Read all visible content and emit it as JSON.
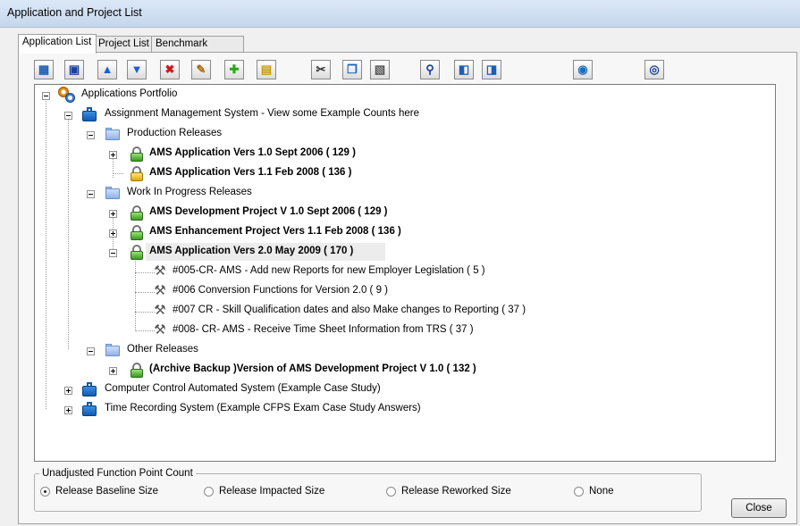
{
  "window": {
    "title": "Application and Project List"
  },
  "tabs": [
    {
      "label": "Application List",
      "active": true
    },
    {
      "label": "Project List",
      "active": false
    },
    {
      "label": "Benchmark Metrics",
      "active": false
    }
  ],
  "toolbar": [
    {
      "icon": "open-icon",
      "glyph": "▦",
      "color": "#1a5fb4"
    },
    {
      "icon": "save-icon",
      "glyph": "▣",
      "color": "#1a3f9c"
    },
    {
      "icon": "arrow-up-icon",
      "glyph": "▲",
      "color": "#1a5fd0"
    },
    {
      "icon": "arrow-down-icon",
      "glyph": "▼",
      "color": "#1a5fd0"
    },
    {
      "icon": "delete-icon",
      "glyph": "✖",
      "color": "#d01818"
    },
    {
      "icon": "edit-icon",
      "glyph": "✎",
      "color": "#b06a10"
    },
    {
      "icon": "add-icon",
      "glyph": "✚",
      "color": "#2aa81a"
    },
    {
      "icon": "export-icon",
      "glyph": "▤",
      "color": "#c89a10"
    },
    {
      "icon": "cut-icon",
      "glyph": "✂",
      "color": "#333333"
    },
    {
      "icon": "copy-icon",
      "glyph": "❐",
      "color": "#1a5fb4"
    },
    {
      "icon": "paste-icon",
      "glyph": "▧",
      "color": "#555555"
    },
    {
      "icon": "find-icon",
      "glyph": "⚲",
      "color": "#1a3f9c"
    },
    {
      "icon": "previous-icon",
      "glyph": "◧",
      "color": "#1a5fb4"
    },
    {
      "icon": "next-icon",
      "glyph": "◨",
      "color": "#1a5fb4"
    },
    {
      "icon": "camera-icon",
      "glyph": "◉",
      "color": "#1a6fc0"
    },
    {
      "icon": "refresh-icon",
      "glyph": "◎",
      "color": "#1a3f9c"
    }
  ],
  "tree": {
    "root": "Applications Portfolio",
    "ams": "Assignment Management System - View some Example Counts here",
    "production_releases": "Production Releases",
    "ams_v10": "AMS Application  Vers 1.0 Sept 2006 ( 129 )",
    "ams_v11": "AMS Application  Vers 1.1 Feb 2008 ( 136 )",
    "wip_releases": "Work In Progress Releases",
    "ams_dev": "AMS Development Project V 1.0 Sept 2006 ( 129 )",
    "ams_enh": "AMS Enhancement Project Vers 1.1 Feb 2008 ( 136 )",
    "ams_v20": "AMS Application  Vers 2.0  May 2009 ( 170 )",
    "cr_005": "#005-CR- AMS - Add new Reports for new Employer Legislation ( 5 )",
    "cr_006": "#006 Conversion Functions for Version 2.0 ( 9 )",
    "cr_007": "#007 CR  - Skill Qualification dates and also Make changes to Reporting ( 37 )",
    "cr_008": "#008- CR- AMS - Receive Time Sheet Information from TRS ( 37 )",
    "other_releases": "Other Releases",
    "archive": "(Archive Backup )Version of  AMS Development Project V 1.0 ( 132 )",
    "computer_control": "Computer Control Automated System (Example Case Study)",
    "time_recording": "Time Recording System (Example CFPS Exam Case Study Answers)"
  },
  "ufp": {
    "legend": "Unadjusted Function Point Count",
    "options": [
      {
        "label": "Release Baseline Size",
        "selected": true
      },
      {
        "label": "Release Impacted Size",
        "selected": false
      },
      {
        "label": "Release Reworked Size",
        "selected": false
      },
      {
        "label": "None",
        "selected": false
      }
    ]
  },
  "buttons": {
    "close": "Close"
  }
}
